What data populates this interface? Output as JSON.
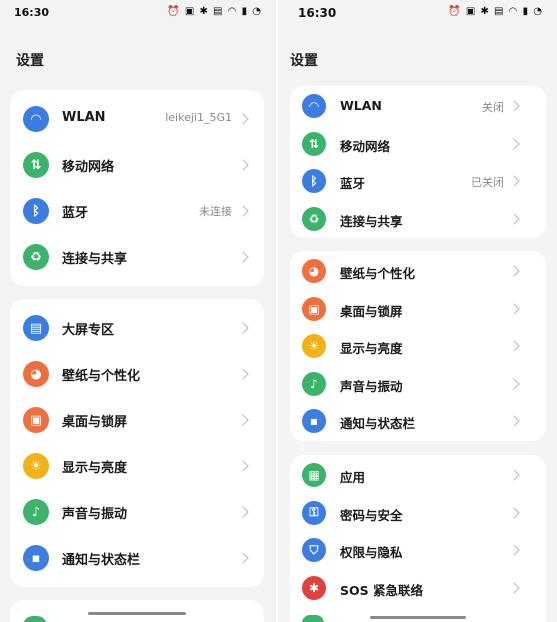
{
  "left": {
    "time": "16:30",
    "status_icons": "⏰ ▣ ✱ ▤ ◠ ▮ ◔",
    "title": "设置",
    "group1": [
      {
        "label": "WLAN",
        "value": "leikeji1_5G1",
        "icon": "wifi-icon",
        "color": "#3b7de0",
        "glyph": "◠"
      },
      {
        "label": "移动网络",
        "value": "",
        "icon": "mobile-data-icon",
        "color": "#3bb36a",
        "glyph": "⇅"
      },
      {
        "label": "蓝牙",
        "value": "未连接",
        "icon": "bluetooth-icon",
        "color": "#3b7de0",
        "glyph": "ᛒ"
      },
      {
        "label": "连接与共享",
        "value": "",
        "icon": "share-icon",
        "color": "#3bb36a",
        "glyph": "♻"
      }
    ],
    "group2": [
      {
        "label": "大屏专区",
        "value": "",
        "icon": "large-screen-icon",
        "color": "#3b7de0",
        "glyph": "▤"
      },
      {
        "label": "壁纸与个性化",
        "value": "",
        "icon": "palette-icon",
        "color": "#ee7040",
        "glyph": "◕"
      },
      {
        "label": "桌面与锁屏",
        "value": "",
        "icon": "image-icon",
        "color": "#ee7040",
        "glyph": "▣"
      },
      {
        "label": "显示与亮度",
        "value": "",
        "icon": "sun-icon",
        "color": "#f2b21a",
        "glyph": "☀"
      },
      {
        "label": "声音与振动",
        "value": "",
        "icon": "bell-icon",
        "color": "#3bb36a",
        "glyph": "♪"
      },
      {
        "label": "通知与状态栏",
        "value": "",
        "icon": "notification-icon",
        "color": "#3b7de0",
        "glyph": "▪"
      }
    ]
  },
  "right": {
    "time": "16:30",
    "status_icons": "⏰ ▣ ✱ ▤ ◠ ▮ ◔",
    "title": "设置",
    "group1": [
      {
        "label": "WLAN",
        "value": "关闭",
        "icon": "wifi-icon",
        "color": "#3b7de0",
        "glyph": "◠"
      },
      {
        "label": "移动网络",
        "value": "",
        "icon": "mobile-data-icon",
        "color": "#3bb36a",
        "glyph": "⇅"
      },
      {
        "label": "蓝牙",
        "value": "已关闭",
        "icon": "bluetooth-icon",
        "color": "#3b7de0",
        "glyph": "ᛒ"
      },
      {
        "label": "连接与共享",
        "value": "",
        "icon": "share-icon",
        "color": "#3bb36a",
        "glyph": "♻"
      }
    ],
    "group2": [
      {
        "label": "壁纸与个性化",
        "value": "",
        "icon": "palette-icon",
        "color": "#ee7040",
        "glyph": "◕"
      },
      {
        "label": "桌面与锁屏",
        "value": "",
        "icon": "image-icon",
        "color": "#ee7040",
        "glyph": "▣"
      },
      {
        "label": "显示与亮度",
        "value": "",
        "icon": "sun-icon",
        "color": "#f2b21a",
        "glyph": "☀"
      },
      {
        "label": "声音与振动",
        "value": "",
        "icon": "bell-icon",
        "color": "#3bb36a",
        "glyph": "♪"
      },
      {
        "label": "通知与状态栏",
        "value": "",
        "icon": "notification-icon",
        "color": "#3b7de0",
        "glyph": "▪"
      }
    ],
    "group3": [
      {
        "label": "应用",
        "value": "",
        "icon": "apps-icon",
        "color": "#3bb36a",
        "glyph": "▦"
      },
      {
        "label": "密码与安全",
        "value": "",
        "icon": "key-icon",
        "color": "#3b7de0",
        "glyph": "⚿"
      },
      {
        "label": "权限与隐私",
        "value": "",
        "icon": "shield-icon",
        "color": "#3b7de0",
        "glyph": "⛉"
      },
      {
        "label": "SOS 紧急联络",
        "value": "",
        "icon": "sos-icon",
        "color": "#e0413a",
        "glyph": "✱"
      }
    ]
  }
}
